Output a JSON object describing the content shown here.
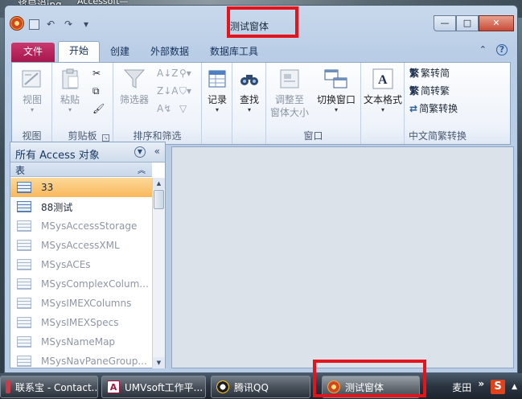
{
  "desktop": {
    "text_left": "将异说jpg",
    "text_right": "Accessoft—\n里FanFach"
  },
  "window": {
    "title": "测试窗体",
    "controls": {
      "minimize": "—",
      "maximize": "□",
      "close": "✕"
    }
  },
  "quick_access": {
    "undo": "↶",
    "redo": "↷",
    "customize": "▾"
  },
  "ribbon_tabs": [
    {
      "label": "文件"
    },
    {
      "label": "开始"
    },
    {
      "label": "创建"
    },
    {
      "label": "外部数据"
    },
    {
      "label": "数据库工具"
    }
  ],
  "ribbon_right": {
    "collapse": "⌃",
    "help": "?"
  },
  "groups": {
    "view": {
      "label": "视图",
      "btn_view": "视图"
    },
    "clipboard": {
      "label": "剪贴板",
      "btn_paste": "粘贴"
    },
    "sort_filter": {
      "label": "排序和筛选",
      "btn_filter": "筛选器"
    },
    "records": {
      "btn_records": "记录"
    },
    "find": {
      "btn_find": "查找"
    },
    "window": {
      "label": "窗口",
      "btn_fit": "调整至\n窗体大小",
      "btn_switch": "切换窗口"
    },
    "text": {
      "btn_text_format": "文本格式"
    },
    "chinese": {
      "label": "中文简繁转换",
      "to_simplified": "繁转简",
      "to_traditional": "简转繁",
      "convert": "简繁转换"
    }
  },
  "nav": {
    "header": "所有 Access 对象",
    "group": "表",
    "items": [
      {
        "name": "33",
        "selected": true,
        "system": false
      },
      {
        "name": "88测试",
        "selected": false,
        "system": false
      },
      {
        "name": "MSysAccessStorage",
        "selected": false,
        "system": true
      },
      {
        "name": "MSysAccessXML",
        "selected": false,
        "system": true
      },
      {
        "name": "MSysACEs",
        "selected": false,
        "system": true
      },
      {
        "name": "MSysComplexColum...",
        "selected": false,
        "system": true
      },
      {
        "name": "MSysIMEXColumns",
        "selected": false,
        "system": true
      },
      {
        "name": "MSysIMEXSpecs",
        "selected": false,
        "system": true
      },
      {
        "name": "MSysNameMap",
        "selected": false,
        "system": true
      },
      {
        "name": "MSysNavPaneGroup...",
        "selected": false,
        "system": true
      }
    ]
  },
  "taskbar": {
    "items": [
      {
        "label": "联系宝 - Contact...",
        "icon": "contacts-icon"
      },
      {
        "label": "UMVsoft工作平...",
        "icon": "access-icon",
        "icon_text": "A"
      },
      {
        "label": "腾讯QQ",
        "icon": "qq-icon"
      },
      {
        "label": "测试窗体",
        "icon": "app-icon"
      }
    ],
    "tray_text": "麦田",
    "tray_more": "»",
    "tray_logo": "S",
    "tray_up": "▲"
  },
  "colors": {
    "highlight": "#e3141b",
    "file_tab": "#a6174d",
    "selected_row": "#f9b85a"
  }
}
